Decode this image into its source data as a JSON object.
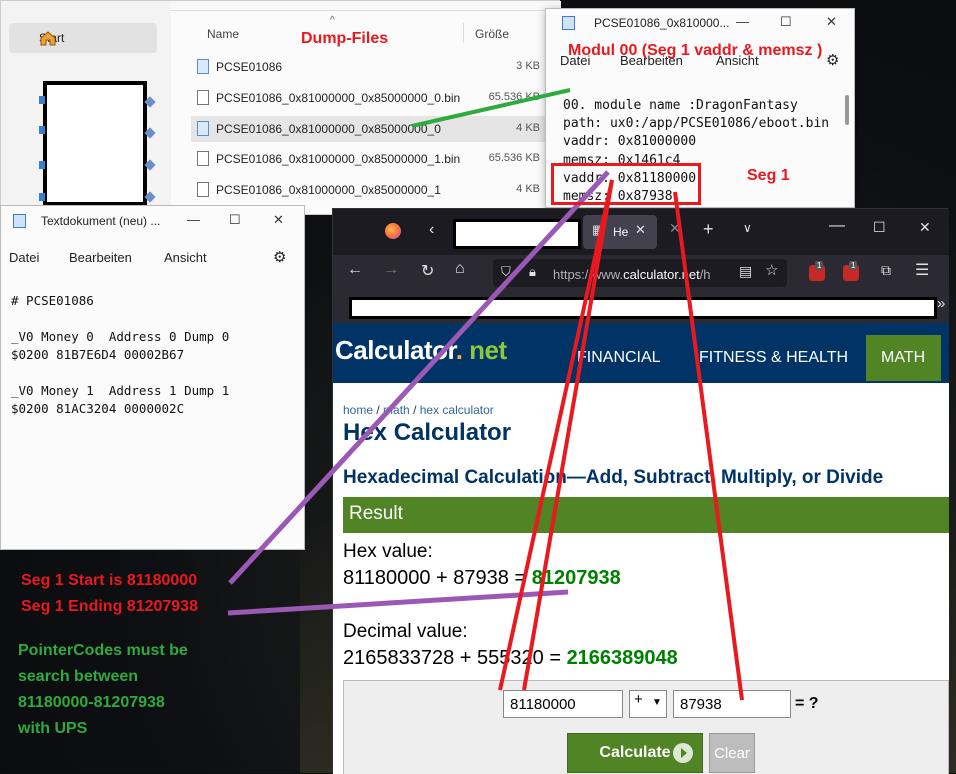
{
  "explorer": {
    "nav_start": "Start",
    "col_name": "Name",
    "col_size": "Größe",
    "files": [
      {
        "name": "PCSE01086",
        "size": "3 KB",
        "type": "note"
      },
      {
        "name": "PCSE01086_0x81000000_0x85000000_0.bin",
        "size": "65.536 KB",
        "type": "bin"
      },
      {
        "name": "PCSE01086_0x81000000_0x85000000_0",
        "size": "4 KB",
        "type": "note"
      },
      {
        "name": "PCSE01086_0x81000000_0x85000000_1.bin",
        "size": "65.536 KB",
        "type": "bin"
      },
      {
        "name": "PCSE01086_0x81000000_0x85000000_1",
        "size": "4 KB",
        "type": "bin"
      }
    ]
  },
  "notepad_module": {
    "title": "PCSE01086_0x810000...",
    "menu": [
      "Datei",
      "Bearbeiten",
      "Ansicht"
    ],
    "lines": "00. module name :DragonFantasy\npath: ux0:/app/PCSE01086/eboot.bin\nvaddr: 0x81000000\nmemsz: 0x1461c4\nvaddr: 0x81180000\nmemsz: 0x87938"
  },
  "notepad_codes": {
    "title": "Textdokument (neu) ...",
    "menu": [
      "Datei",
      "Bearbeiten",
      "Ansicht"
    ],
    "lines": "# PCSE01086\n\n_V0 Money 0  Address 0 Dump 0\n$0200 81B7E6D4 00002B67\n\n_V0 Money 1  Address 1 Dump 1\n$0200 81AC3204 0000002C"
  },
  "firefox": {
    "tab_label": "He",
    "url_prefix": "https://www.",
    "url_host": "calculator.net",
    "url_suffix": "/h",
    "badge_count": "1"
  },
  "calculator": {
    "logo_main": "Calculator",
    "logo_dot": ".",
    "logo_tld": " net",
    "nav": [
      "FINANCIAL",
      "FITNESS & HEALTH",
      "MATH"
    ],
    "crumb_home": "home",
    "crumb_math": "math",
    "crumb_current": "hex calculator",
    "crumb_sep": " / ",
    "title": "Hex Calculator",
    "subtitle": "Hexadecimal Calculation—Add, Subtract, Multiply, or Divide",
    "result_label": "Result",
    "hex_label": "Hex value:",
    "hex_expr": "81180000 + 87938 = ",
    "hex_result": "81207938",
    "dec_label": "Decimal value:",
    "dec_expr": "2165833728 + 555320 = ",
    "dec_result": "2166389048",
    "input_a": "81180000",
    "operator": "+",
    "input_b": "87938",
    "eq": "= ?",
    "calculate": "Calculate",
    "clear": "Clear"
  },
  "annotations": {
    "dump_files": "Dump-Files",
    "modul": "Modul 00 (Seg 1 vaddr & memsz )",
    "seg1": "Seg 1",
    "seg_start": "Seg 1 Start is 81180000",
    "seg_end": "Seg 1 Ending 81207938",
    "pointer_1": "PointerCodes must be",
    "pointer_2": "search between",
    "pointer_3": "81180000-81207938",
    "pointer_4": "with UPS",
    "color_red": "#e8191f",
    "color_green": "#2faa3f",
    "color_purple": "#9b59b6"
  },
  "window_controls": {
    "minimize": "—",
    "maximize": "☐",
    "close": "✕"
  }
}
